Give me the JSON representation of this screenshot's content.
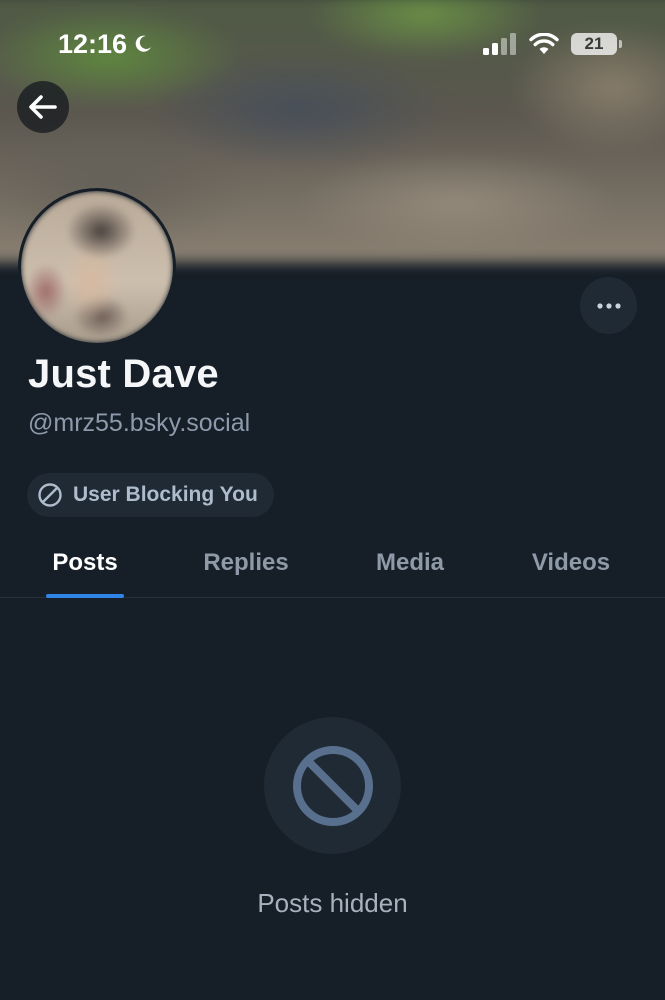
{
  "status_bar": {
    "time": "12:16",
    "battery": "21"
  },
  "profile": {
    "display_name": "Just Dave",
    "handle": "@mrz55.bsky.social",
    "blocking_badge": "User Blocking You"
  },
  "tabs": [
    {
      "label": "Posts",
      "active": true
    },
    {
      "label": "Replies",
      "active": false
    },
    {
      "label": "Media",
      "active": false
    },
    {
      "label": "Videos",
      "active": false
    }
  ],
  "empty_state": {
    "label": "Posts hidden"
  },
  "icons": {
    "back": "arrow-left-icon",
    "more": "ellipsis-icon",
    "blocked": "block-icon",
    "moon": "moon-icon",
    "signal": "cellular-signal-icon",
    "wifi": "wifi-icon"
  },
  "colors": {
    "background": "#161e27",
    "accent": "#2f86e8",
    "muted_text": "#8c9aab",
    "chip": "#1f2a35"
  }
}
